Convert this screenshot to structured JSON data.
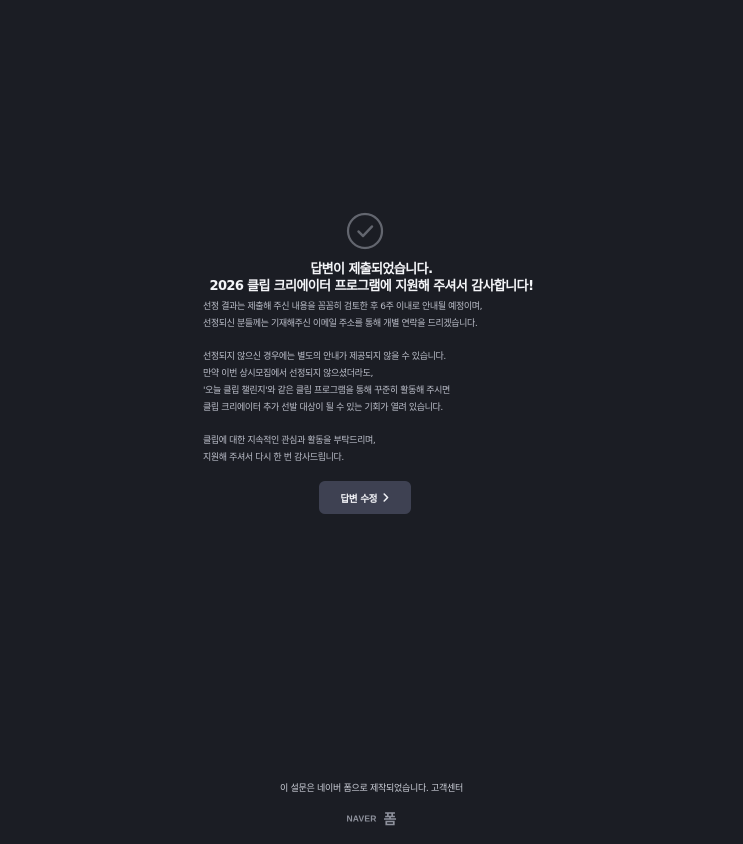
{
  "confirmation": {
    "icon": "check-circle-icon",
    "title_line1": "답변이 제출되었습니다.",
    "title_line2": "2026 클립 크리에이터 프로그램에 지원해 주셔서 감사합니다!",
    "paragraphs": [
      {
        "lines": [
          "선정 결과는 제출해 주신 내용을 꼼꼼히 검토한 후 6주 이내로 안내될 예정이며,",
          "선정되신 분들께는 기재해주신 이메일 주소를 통해 개별 연락을 드리겠습니다."
        ]
      },
      {
        "lines": [
          "선정되지 않으신 경우에는 별도의 안내가 제공되지 않을 수 있습니다.",
          "만약 이번 상시모집에서 선정되지 않으셨더라도,",
          "'오늘 클립 챌린지'와  같은 클립 프로그램을 통해 꾸준히 활동해 주시면",
          "클립 크리에이터 추가 선발 대상이 될 수 있는 기회가 열려 있습니다."
        ]
      },
      {
        "lines": [
          "클립에 대한 지속적인 관심과 활동을 부탁드리며,",
          "지원해 주셔서 다시 한 번 감사드립니다."
        ]
      }
    ],
    "edit_button_label": "답변 수정",
    "edit_button_icon": "chevron-right-icon"
  },
  "footer": {
    "text": "이 설문은 네이버 폼으로 제작되었습니다.",
    "link_label": "고객센터",
    "logo_naver": "NAVER",
    "logo_form": "폼"
  },
  "colors": {
    "background": "#1b1d24",
    "button": "#3e4152",
    "icon_stroke": "#63666f"
  }
}
